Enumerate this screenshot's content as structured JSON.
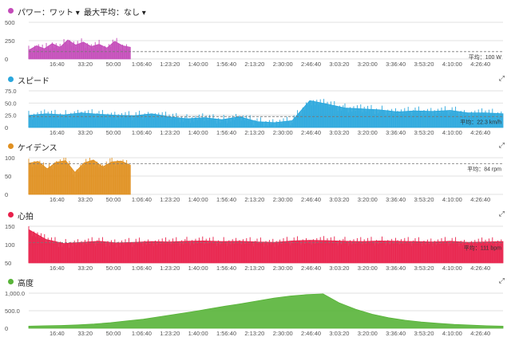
{
  "x_ticks": [
    "16:40",
    "33:20",
    "50:00",
    "1:06:40",
    "1:23:20",
    "1:40:00",
    "1:56:40",
    "2:13:20",
    "2:30:00",
    "2:46:40",
    "3:03:20",
    "3:20:00",
    "3:36:40",
    "3:53:20",
    "4:10:00",
    "4:26:40"
  ],
  "panels": [
    {
      "key": "power",
      "title": "パワー：ワット ▾",
      "dropdown": "最大平均：なし ▾",
      "color": "#c44bb9",
      "y_ticks": [
        "500",
        "250",
        "0"
      ],
      "avg_label": "平均：100 W",
      "expand": ""
    },
    {
      "key": "speed",
      "title": "スピード",
      "dropdown": "",
      "color": "#2aa7dd",
      "y_ticks": [
        "75.0",
        "50.0",
        "25.0",
        "0"
      ],
      "avg_label": "平均：22.3 km/h",
      "expand": "⤢"
    },
    {
      "key": "cadence",
      "title": "ケイデンス",
      "dropdown": "",
      "color": "#e09020",
      "y_ticks": [
        "100",
        "50",
        "0"
      ],
      "avg_label": "平均：84 rpm",
      "expand": "⤢"
    },
    {
      "key": "hr",
      "title": "心拍",
      "dropdown": "",
      "color": "#e8204a",
      "y_ticks": [
        "150",
        "100",
        "50"
      ],
      "avg_label": "平均：111 bpm",
      "expand": "⤢"
    },
    {
      "key": "elevation",
      "title": "高度",
      "dropdown": "",
      "color": "#58b438",
      "y_ticks": [
        "1,000.0",
        "500.0",
        "0"
      ],
      "avg_label": "",
      "expand": "⤢"
    }
  ],
  "chart_data": [
    {
      "type": "area",
      "title": "パワー：ワット",
      "ylim": [
        0,
        500
      ],
      "x_range_seconds": [
        0,
        16800
      ],
      "data_end_seconds": 3600,
      "average": 100,
      "units": "W",
      "values": [
        120,
        180,
        140,
        210,
        160,
        260,
        190,
        230,
        170,
        200,
        150,
        240,
        180,
        160
      ]
    },
    {
      "type": "area",
      "title": "スピード",
      "ylim": [
        0,
        75
      ],
      "x_range_seconds": [
        0,
        16800
      ],
      "average": 22.3,
      "units": "km/h",
      "values": [
        25,
        28,
        26,
        30,
        27,
        25,
        24,
        28,
        22,
        18,
        20,
        16,
        22,
        12,
        10,
        14,
        55,
        48,
        40,
        38,
        36,
        32,
        34,
        33,
        35,
        30,
        30,
        28
      ]
    },
    {
      "type": "area",
      "title": "ケイデンス",
      "ylim": [
        0,
        100
      ],
      "x_range_seconds": [
        0,
        16800
      ],
      "data_end_seconds": 3600,
      "average": 84,
      "units": "rpm",
      "values": [
        85,
        90,
        70,
        88,
        92,
        60,
        86,
        94,
        75,
        89,
        91,
        80
      ]
    },
    {
      "type": "area",
      "title": "心拍",
      "ylim": [
        50,
        160
      ],
      "x_range_seconds": [
        0,
        16800
      ],
      "average": 111,
      "units": "bpm",
      "values": [
        150,
        120,
        108,
        112,
        115,
        110,
        112,
        114,
        113,
        115,
        116,
        114,
        115,
        113,
        112,
        116,
        118,
        117,
        115,
        114,
        116,
        115,
        114,
        113,
        115,
        112,
        113,
        114
      ]
    },
    {
      "type": "area",
      "title": "高度",
      "ylim": [
        0,
        1000
      ],
      "x_range_seconds": [
        0,
        16800
      ],
      "values": [
        60,
        70,
        80,
        95,
        120,
        160,
        210,
        260,
        330,
        400,
        470,
        550,
        630,
        700,
        780,
        860,
        920,
        960,
        980,
        720,
        540,
        400,
        300,
        230,
        180,
        140,
        110,
        90,
        70,
        60
      ]
    }
  ]
}
